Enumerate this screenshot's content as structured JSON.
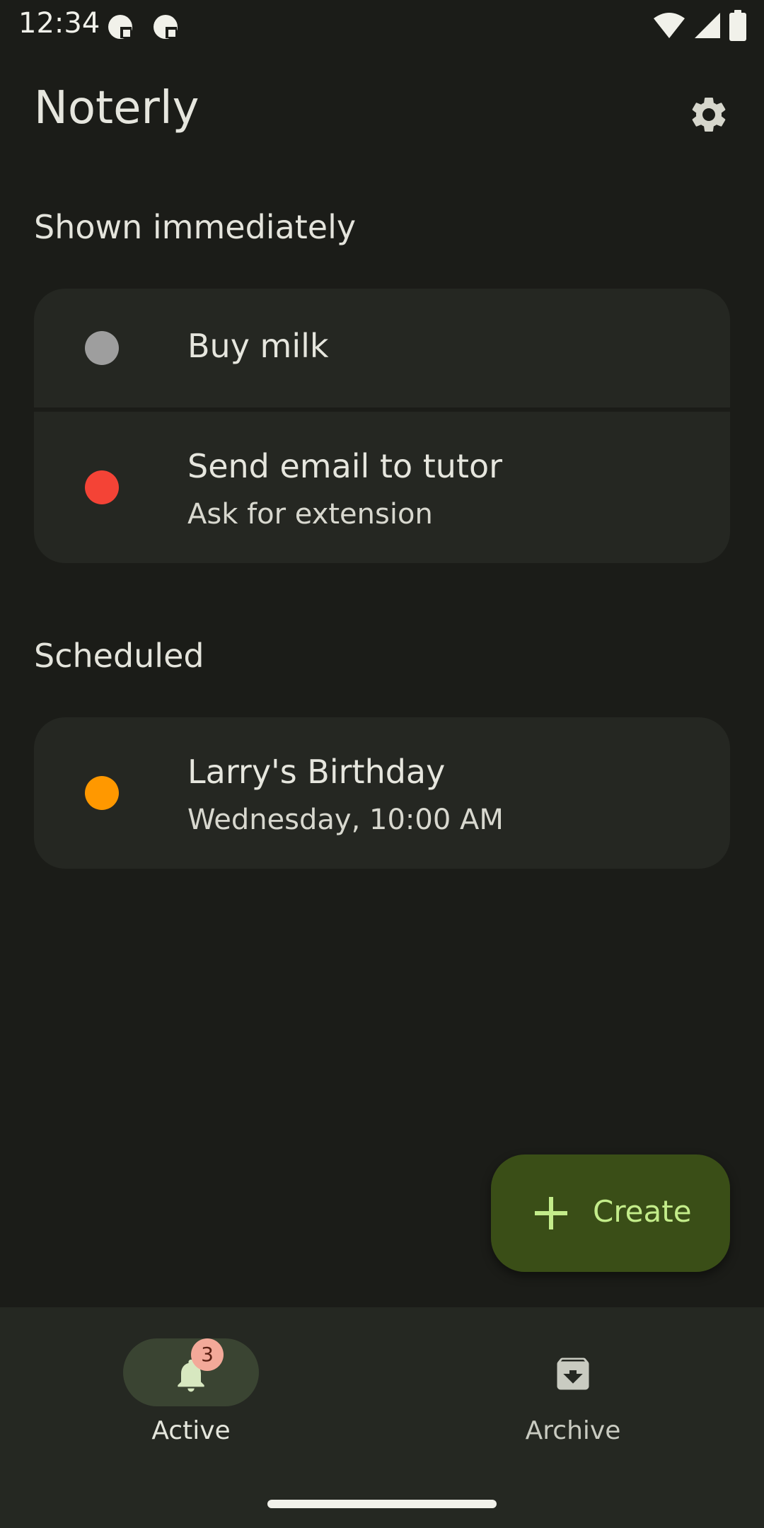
{
  "status_bar": {
    "time": "12:34",
    "icons": [
      "app-notification-icon",
      "app-notification-icon",
      "wifi-icon",
      "cell-signal-icon",
      "battery-icon"
    ]
  },
  "app_bar": {
    "title": "Noterly",
    "settings_icon": "gear-icon"
  },
  "sections": {
    "immediate": {
      "title": "Shown immediately",
      "items": [
        {
          "title": "Buy milk",
          "subtitle": "",
          "color": "#9e9e9e"
        },
        {
          "title": "Send email to tutor",
          "subtitle": "Ask for extension",
          "color": "#f44336"
        }
      ]
    },
    "scheduled": {
      "title": "Scheduled",
      "items": [
        {
          "title": "Larry's Birthday",
          "subtitle": "Wednesday, 10:00 AM",
          "color": "#ff9800"
        }
      ]
    }
  },
  "fab": {
    "label": "Create",
    "icon": "plus-icon"
  },
  "bottom_nav": {
    "items": [
      {
        "label": "Active",
        "icon": "bell-icon",
        "badge": "3",
        "selected": true
      },
      {
        "label": "Archive",
        "icon": "archive-icon",
        "selected": false
      }
    ]
  },
  "colors": {
    "background": "#1b1c18",
    "card": "#252722",
    "fab": "#3a4e17",
    "accent": "#c3ec8a",
    "nav_pill": "#3a4432"
  }
}
